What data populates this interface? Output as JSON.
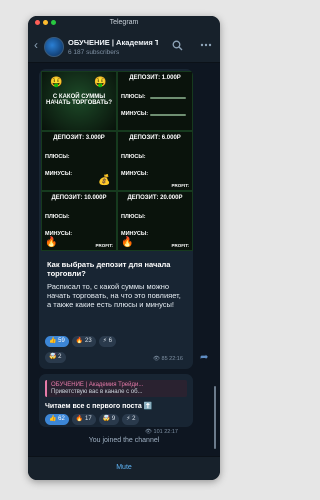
{
  "window": {
    "title": "Telegram"
  },
  "header": {
    "channel_name": "ОБУЧЕНИЕ | Академия Тр...",
    "subscribers": "6 187 subscribers"
  },
  "post": {
    "images": [
      {
        "title": "С КАКОЙ СУММЫ НАЧАТЬ ТОРГОВАТЬ?"
      },
      {
        "title": "ДЕПОЗИТ: 1.000Р",
        "plus": "ПЛЮСЫ:",
        "minus": "МИНУСЫ:"
      },
      {
        "title": "ДЕПОЗИТ: 3.000Р",
        "plus": "ПЛЮСЫ:",
        "minus": "МИНУСЫ:"
      },
      {
        "title": "ДЕПОЗИТ: 6.000Р",
        "plus": "ПЛЮСЫ:",
        "minus": "МИНУСЫ:",
        "profit": "PROFIT:"
      },
      {
        "title": "ДЕПОЗИТ: 10.000Р",
        "plus": "ПЛЮСЫ:",
        "minus": "МИНУСЫ:",
        "profit": "PROFIT:"
      },
      {
        "title": "ДЕПОЗИТ: 20.000Р",
        "plus": "ПЛЮСЫ:",
        "minus": "МИНУСЫ:",
        "profit": "PROFIT:"
      }
    ],
    "title": "Как выбрать депозит для начала торговли?",
    "body": "Расписал то, с какой суммы можно начать торговать, на что это повлияет, а также какие есть плюсы и минусы!",
    "reactions": [
      {
        "emoji": "👍",
        "count": "59"
      },
      {
        "emoji": "🔥",
        "count": "23"
      },
      {
        "emoji": "⚡",
        "count": "6"
      }
    ],
    "extra_reaction": {
      "emoji": "🤯",
      "count": "2"
    },
    "views_time": "85 22:16"
  },
  "post2": {
    "reply_author": "ОБУЧЕНИЕ | Академия Трейди...",
    "reply_text": "Приветствую вас в канале с об...",
    "text": "Читаем все с первого поста ⬆️",
    "reactions": [
      {
        "emoji": "👍",
        "count": "62"
      },
      {
        "emoji": "🔥",
        "count": "17"
      },
      {
        "emoji": "🤯",
        "count": "9"
      },
      {
        "emoji": "⚡",
        "count": "2"
      }
    ],
    "views_time": "101 22:17"
  },
  "service_message": "You joined the channel",
  "bottom_button": "Mute",
  "icons": {
    "back": "back-arrow-icon",
    "search": "search-icon",
    "more": "more-icon",
    "share": "share-icon",
    "views": "eye-icon"
  },
  "colors": {
    "accent": "#5eb5f7",
    "bubble": "#182533",
    "background": "#0e1621",
    "reaction_active": "#3c86d6"
  }
}
